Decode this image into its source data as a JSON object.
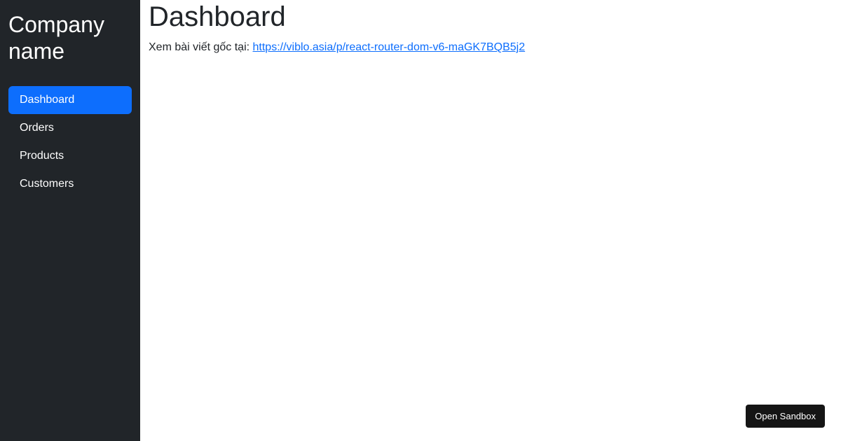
{
  "sidebar": {
    "brand": "Company name",
    "items": [
      {
        "label": "Dashboard",
        "active": true
      },
      {
        "label": "Orders",
        "active": false
      },
      {
        "label": "Products",
        "active": false
      },
      {
        "label": "Customers",
        "active": false
      }
    ]
  },
  "main": {
    "title": "Dashboard",
    "intro_prefix": "Xem bài viết gốc tại: ",
    "link_text": "https://viblo.asia/p/react-router-dom-v6-maGK7BQB5j2",
    "link_href": "https://viblo.asia/p/react-router-dom-v6-maGK7BQB5j2"
  },
  "sandbox": {
    "label": "Open Sandbox"
  },
  "colors": {
    "sidebar_bg": "#212529",
    "active_item": "#0d6efd",
    "link": "#0d6efd",
    "sandbox_bg": "#151515"
  }
}
